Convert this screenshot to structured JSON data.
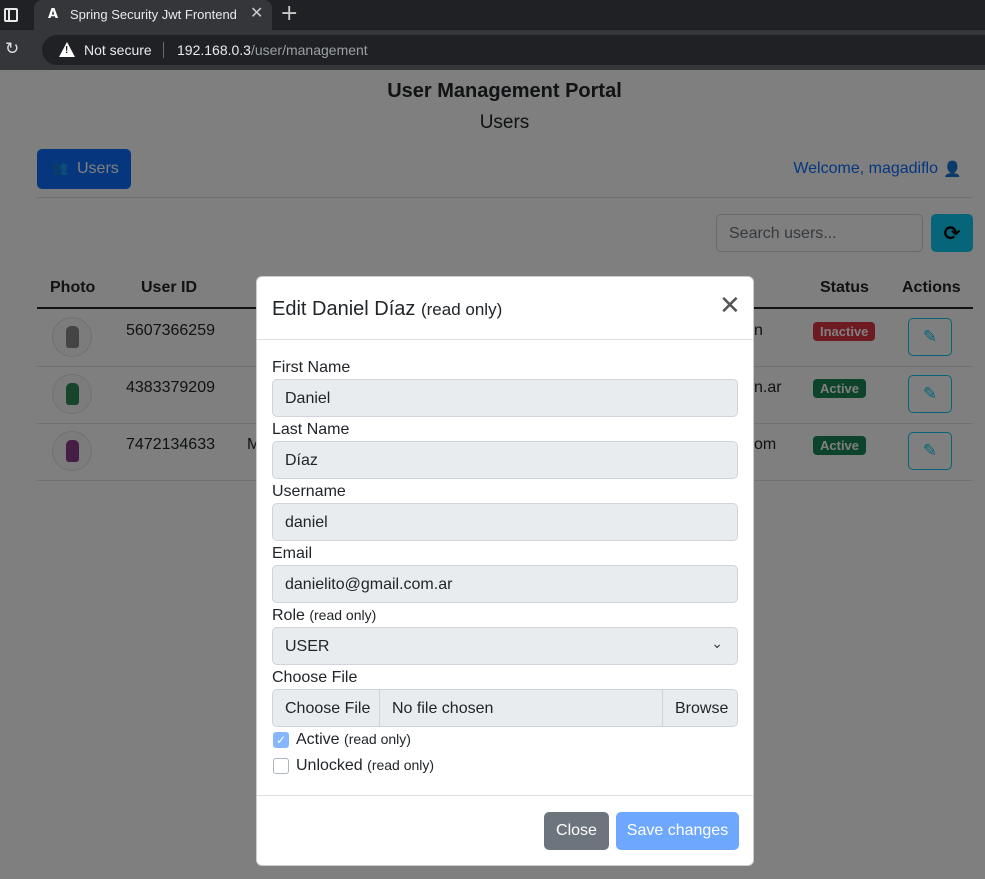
{
  "browser": {
    "tab_title": "Spring Security Jwt Frontend",
    "tab_close": "✕",
    "new_tab": "+",
    "security_label": "Not secure",
    "url_host": "192.168.0.3",
    "url_path": "/user/management"
  },
  "app": {
    "title": "User Management Portal",
    "subtitle": "Users",
    "users_button": "Users",
    "welcome": "Welcome, magadiflo",
    "search_placeholder": "Search users..."
  },
  "table": {
    "headers": {
      "photo": "Photo",
      "user_id": "User ID",
      "status": "Status",
      "actions": "Actions"
    },
    "rows": [
      {
        "user_id": "5607366259",
        "mid_fragment": "",
        "email_fragment": "n",
        "status": "Inactive",
        "avatar_color": "#888888"
      },
      {
        "user_id": "4383379209",
        "mid_fragment": "",
        "email_fragment": "n.ar",
        "status": "Active",
        "avatar_color": "#2e8b57"
      },
      {
        "user_id": "7472134633",
        "mid_fragment": "M",
        "email_fragment": "om",
        "status": "Active",
        "avatar_color": "#8b3a8b"
      }
    ]
  },
  "modal": {
    "title": "Edit Daniel Díaz",
    "title_suffix": "(read only)",
    "close_icon": "✕",
    "fields": {
      "first_name_label": "First Name",
      "first_name": "Daniel",
      "last_name_label": "Last Name",
      "last_name": "Díaz",
      "username_label": "Username",
      "username": "daniel",
      "email_label": "Email",
      "email": "danielito@gmail.com.ar",
      "role_label": "Role",
      "role_suffix": "(read only)",
      "role": "USER",
      "file_label": "Choose File",
      "file_button": "Choose File",
      "file_status": "No file chosen",
      "file_browse": "Browse"
    },
    "checkboxes": {
      "active_label": "Active",
      "active_suffix": "(read only)",
      "active_checked": true,
      "unlocked_label": "Unlocked",
      "unlocked_suffix": "(read only)",
      "unlocked_checked": false
    },
    "close_button": "Close",
    "save_button": "Save changes"
  },
  "colors": {
    "primary": "#0d6efd",
    "info": "#0dcaf0",
    "danger": "#dc3545",
    "success": "#198754",
    "secondary": "#6c757d"
  }
}
